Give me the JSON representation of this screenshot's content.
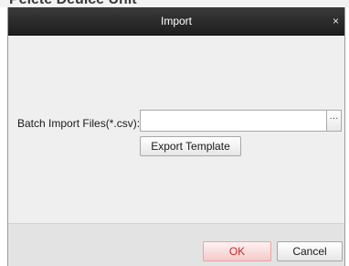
{
  "background_text": "Pelete Deuice Unit",
  "dialog": {
    "title": "Import",
    "close_glyph": "×",
    "field_label": "Batch Import Files(*.csv):",
    "file_path_value": "",
    "browse_label": "···",
    "export_template_label": "Export Template",
    "ok_label": "OK",
    "cancel_label": "Cancel"
  },
  "colors": {
    "titlebar": "#2a2a2a",
    "dialog_body": "#efefef",
    "footer": "#e3e3e3",
    "ok_text": "#c22a2a"
  },
  "icons": {
    "close": "close-icon",
    "browse": "ellipsis-icon"
  }
}
